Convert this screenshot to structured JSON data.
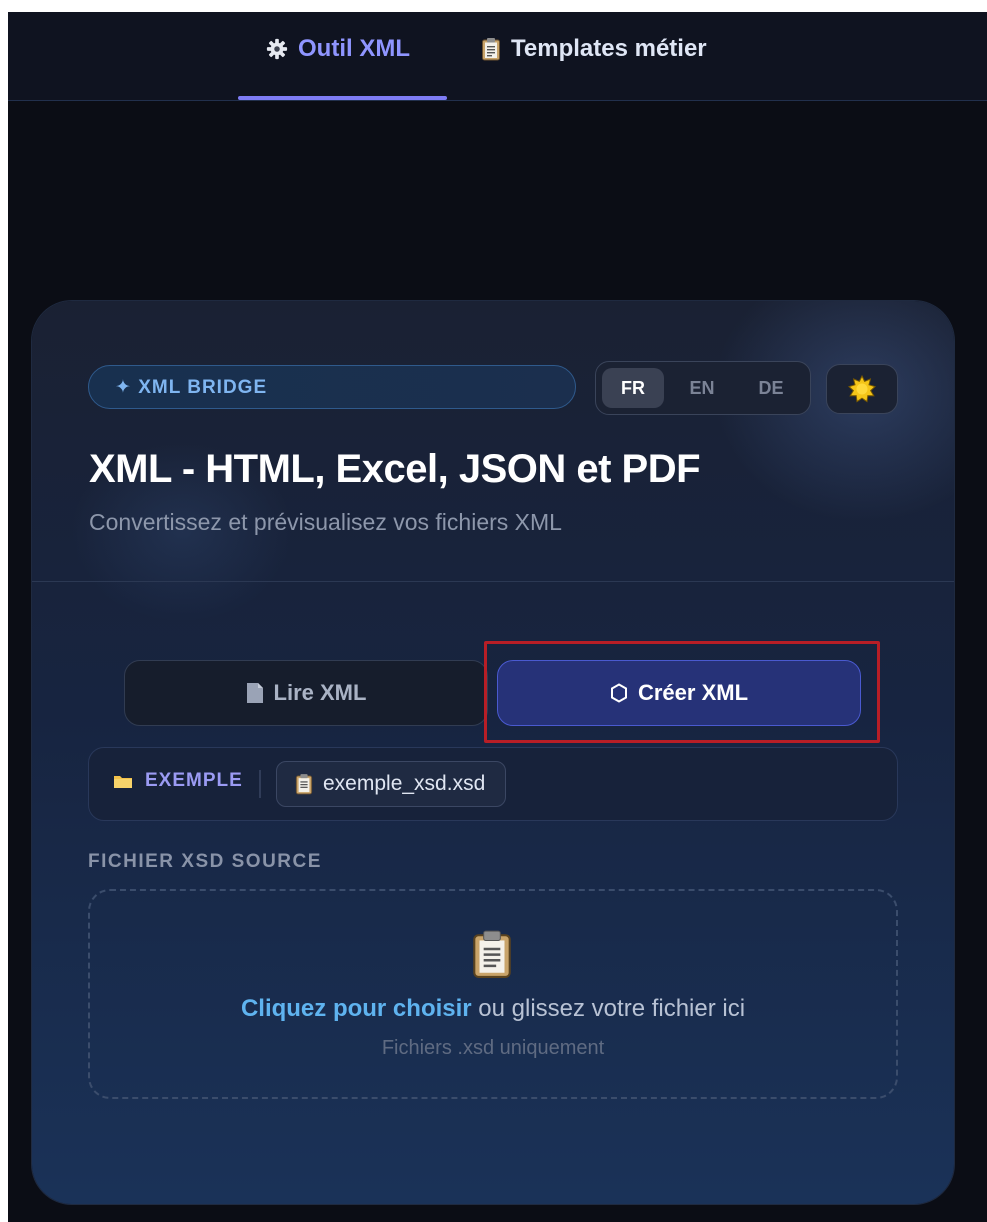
{
  "nav": {
    "tabs": [
      {
        "label": "Outil XML",
        "icon": "gear-icon",
        "active": true
      },
      {
        "label": "Templates métier",
        "icon": "clipboard-icon",
        "active": false
      }
    ]
  },
  "card": {
    "badge": "✦ XML BRIDGE",
    "languages": [
      "FR",
      "EN",
      "DE"
    ],
    "selected_language": "FR",
    "theme_icon": "sun-icon",
    "title": "XML - HTML, Excel, JSON et PDF",
    "subtitle": "Convertissez et prévisualisez vos fichiers XML",
    "modes": {
      "read": {
        "label": "Lire XML",
        "icon": "document-icon"
      },
      "create": {
        "label": "Créer XML",
        "icon": "hexagon-icon",
        "active": true
      }
    },
    "example": {
      "label": "EXEMPLE",
      "icon": "folder-icon",
      "file": "exemple_xsd.xsd",
      "file_icon": "clipboard-icon"
    },
    "source_label": "FICHIER XSD SOURCE",
    "dropzone": {
      "icon": "clipboard-icon",
      "link": "Cliquez pour choisir",
      "text": " ou glissez votre fichier ici",
      "hint": "Fichiers .xsd uniquement"
    }
  },
  "colors": {
    "accent": "#7e7cf4",
    "highlight": "#b81e26",
    "link": "#5fb3ef"
  }
}
